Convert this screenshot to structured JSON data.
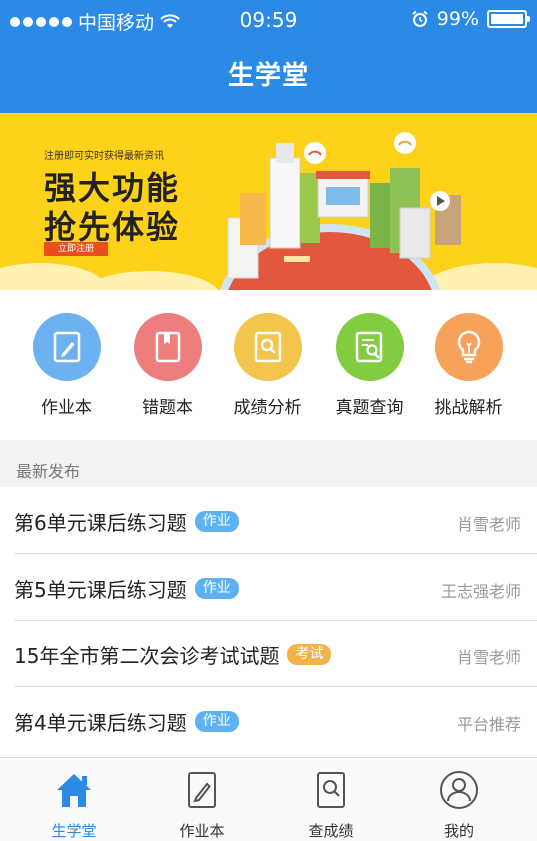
{
  "status_bar": {
    "carrier": "中国移动",
    "time": "09:59",
    "battery": "99%",
    "battery_level": 0.99
  },
  "header": {
    "title": "生学堂"
  },
  "banner": {
    "subtitle": "注册即可实时获得最新资讯",
    "line1": "强大功能",
    "line2": "抢先体验",
    "button": "立即注册"
  },
  "quick_menu": [
    {
      "label": "作业本",
      "icon": "notebook-pen-icon",
      "color": "#6db2f0"
    },
    {
      "label": "错题本",
      "icon": "book-icon",
      "color": "#ee7d7d"
    },
    {
      "label": "成绩分析",
      "icon": "search-doc-icon",
      "color": "#f3c54d"
    },
    {
      "label": "真题查询",
      "icon": "doc-search-icon",
      "color": "#82cc3f"
    },
    {
      "label": "挑战解析",
      "icon": "lightbulb-icon",
      "color": "#f7a15b"
    }
  ],
  "latest": {
    "section_title": "最新发布",
    "items": [
      {
        "title": "第6单元课后练习题",
        "tag": "作业",
        "author": "肖雪老师"
      },
      {
        "title": "第5单元课后练习题",
        "tag": "作业",
        "author": "王志强老师"
      },
      {
        "title": "15年全市第二次会诊考试试题",
        "tag": "考试",
        "author": "肖雪老师"
      },
      {
        "title": "第4单元课后练习题",
        "tag": "作业",
        "author": "平台推荐"
      }
    ]
  },
  "tabbar": {
    "active": "home",
    "items": [
      {
        "label": "生学堂",
        "icon": "home-icon"
      },
      {
        "label": "作业本",
        "icon": "pen-note-icon"
      },
      {
        "label": "查成绩",
        "icon": "search-note-icon"
      },
      {
        "label": "我的",
        "icon": "user-icon"
      }
    ]
  },
  "colors": {
    "primary": "#2a8ae6",
    "tag_homework": "#5eb2f2",
    "tag_exam": "#f4b34a",
    "banner_bg": "#ffd21a"
  }
}
